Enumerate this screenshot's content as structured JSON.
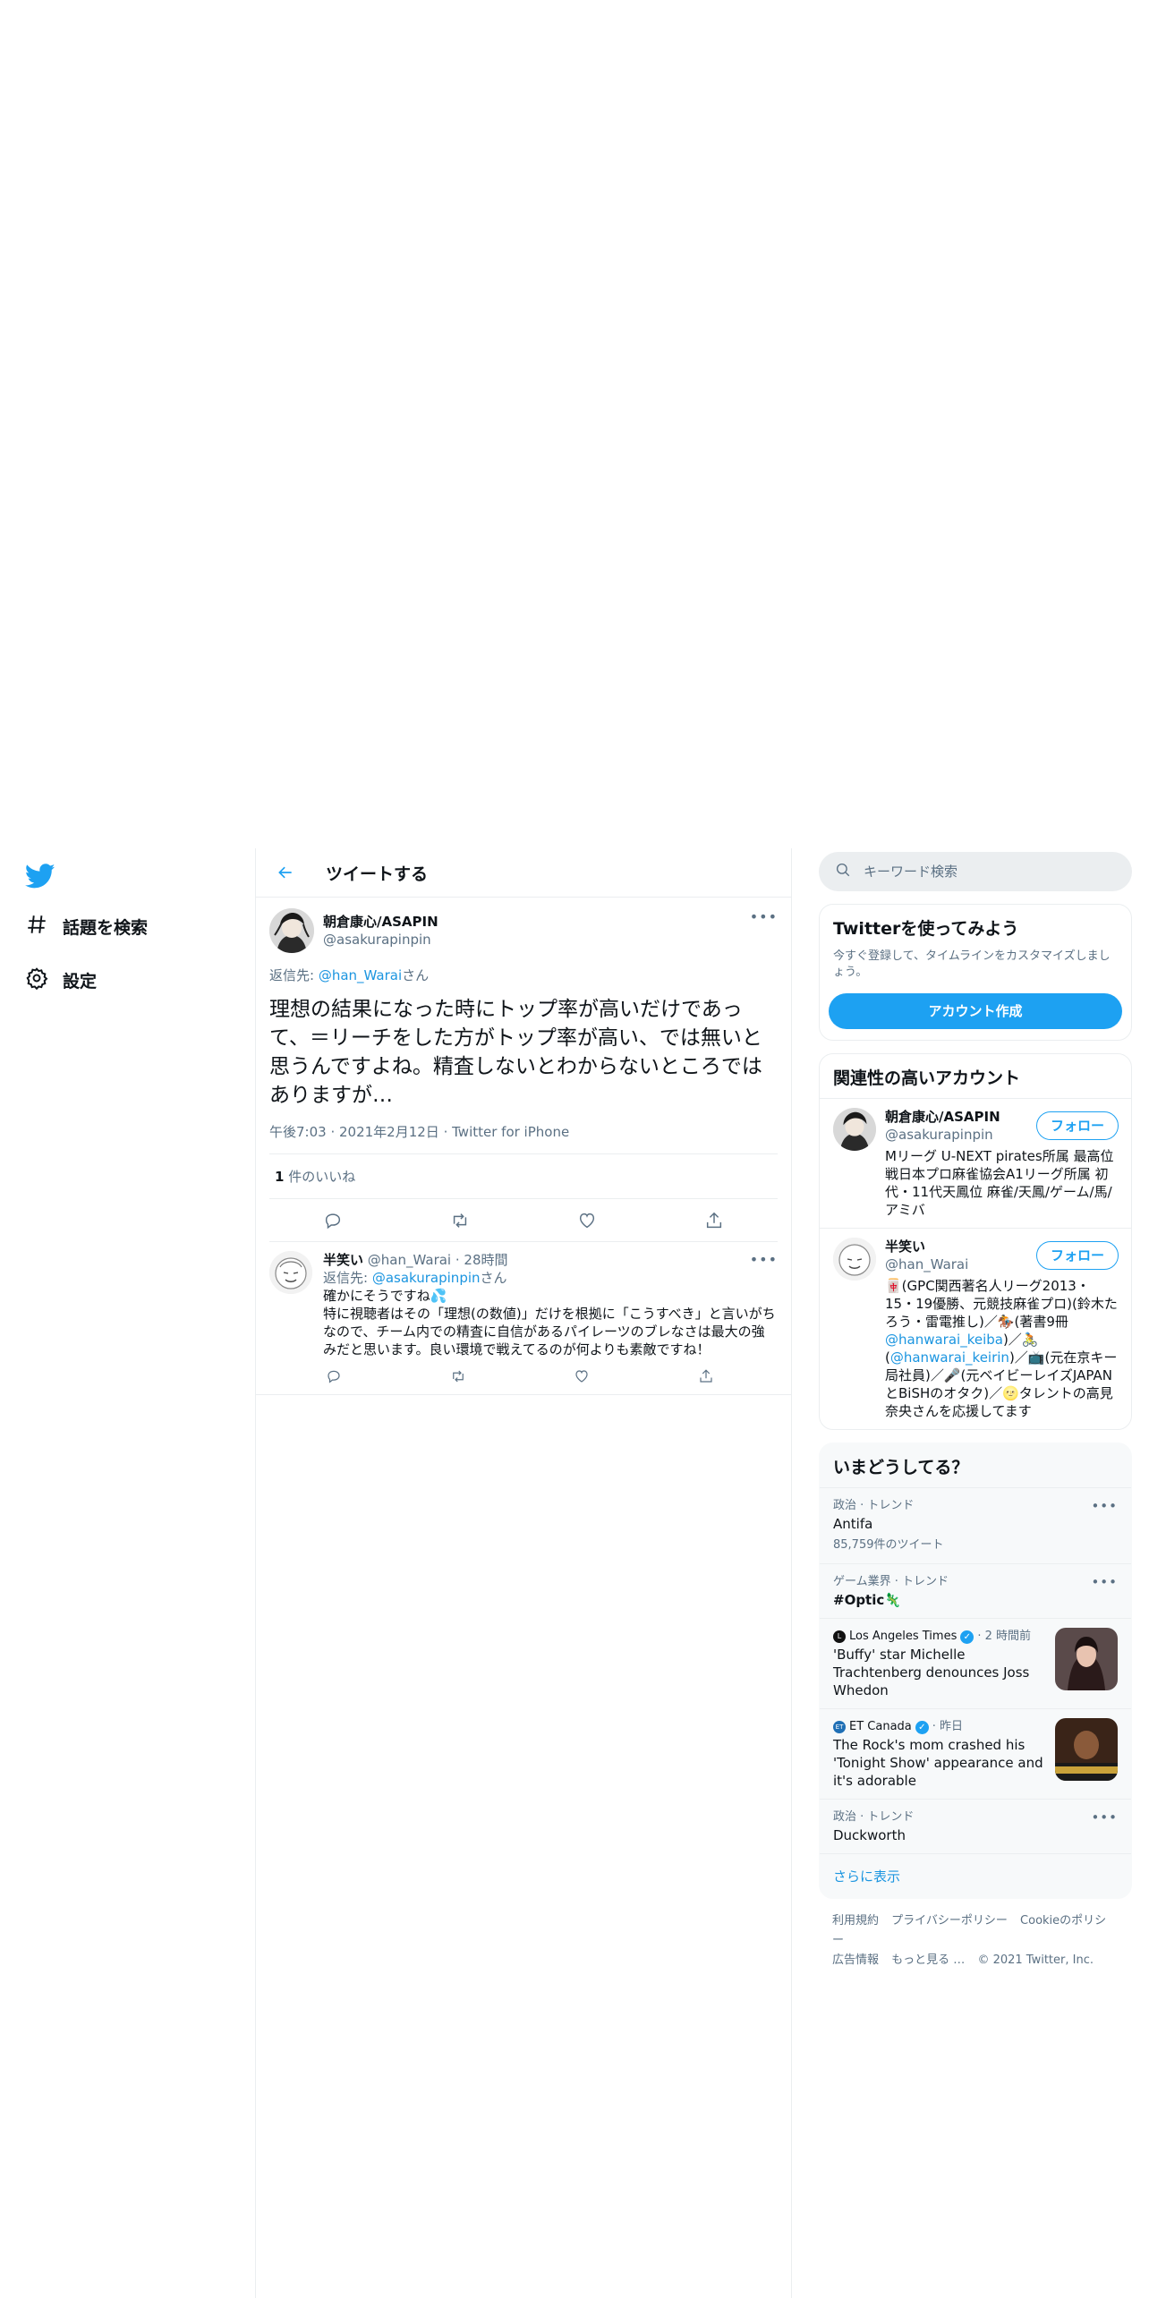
{
  "nav": {
    "logo_icon": "twitter-bird-icon",
    "explore_label": "話題を検索",
    "settings_label": "設定"
  },
  "header": {
    "title": "ツイートする"
  },
  "main_tweet": {
    "name": "朝倉康心/ASAPIN",
    "handle": "@asakurapinpin",
    "reply_prefix": "返信先: ",
    "reply_mention": "@han_Warai",
    "reply_suffix": "さん",
    "text": "理想の結果になった時にトップ率が高いだけであって、＝リーチをした方がトップ率が高い、では無いと思うんですよね。精査しないとわからないところではありますが…",
    "time": "午後7:03",
    "date": "2021年2月12日",
    "client": "Twitter for iPhone",
    "likes_count": "1",
    "likes_label": " 件のいいね"
  },
  "reply": {
    "name": "半笑い",
    "handle": "@han_Warai",
    "time": "28時間",
    "reply_prefix": "返信先: ",
    "reply_mention": "@asakurapinpin",
    "reply_suffix": "さん",
    "text_line1": "確かにそうですね💦",
    "text_line2": "特に視聴者はその「理想(の数値)」だけを根拠に「こうすべき」と言いがちなので、チーム内での精査に自信があるパイレーツのブレなさは最大の強みだと思います。良い環境で戦えてるのが何よりも素敵ですね！"
  },
  "search": {
    "placeholder": "キーワード検索"
  },
  "signup": {
    "title": "Twitterを使ってみよう",
    "subtitle": "今すぐ登録して、タイムラインをカスタマイズしましょう。",
    "button": "アカウント作成"
  },
  "relevant": {
    "title": "関連性の高いアカウント",
    "follow_label": "フォロー",
    "accounts": [
      {
        "name": "朝倉康心/ASAPIN",
        "handle": "@asakurapinpin",
        "bio": "Mリーグ U-NEXT pirates所属 最高位戦日本プロ麻雀協会A1リーグ所属 初代・11代天鳳位 麻雀/天鳳/ゲーム/馬/アミバ"
      },
      {
        "name": "半笑い",
        "handle": "@han_Warai",
        "bio_part1": "🀄(GPC関西著名人リーグ2013・15・19優勝、元競技麻雀プロ)(鈴木たろう・雷電推し)／🏇(著書9冊",
        "bio_mention1": "@hanwarai_keiba",
        "bio_part2": ")／🚴(",
        "bio_mention2": "@hanwarai_keirin",
        "bio_part3": ")／📺(元在京キー局社員)／🎤(元ベイビーレイズJAPANとBiSHのオタク)／🌝タレントの高見奈央さんを応援してます"
      }
    ]
  },
  "trends": {
    "title": "いまどうしてる？",
    "items": [
      {
        "meta": "政治 · トレンド",
        "name": "Antifa",
        "count": "85,759件のツイート"
      },
      {
        "meta": "ゲーム業界 · トレンド",
        "name": "#Optic🦎"
      }
    ],
    "news": [
      {
        "source": "Los Angeles Times",
        "time": "· 2 時間前",
        "headline": "'Buffy' star Michelle Trachtenberg denounces Joss Whedon"
      },
      {
        "source": "ET Canada",
        "time": "· 昨日",
        "headline": "The Rock's mom crashed his 'Tonight Show' appearance and it's adorable"
      }
    ],
    "last": {
      "meta": "政治 · トレンド",
      "name": "Duckworth"
    },
    "show_more": "さらに表示"
  },
  "footer": {
    "terms": "利用規約",
    "privacy": "プライバシーポリシー",
    "cookies": "Cookieのポリシー",
    "ads": "広告情報",
    "more": "もっと見る …",
    "copyright": "© 2021 Twitter, Inc."
  },
  "colors": {
    "accent": "#1da1f2",
    "link": "#1b95e0",
    "secondary_text": "#5b7083"
  }
}
